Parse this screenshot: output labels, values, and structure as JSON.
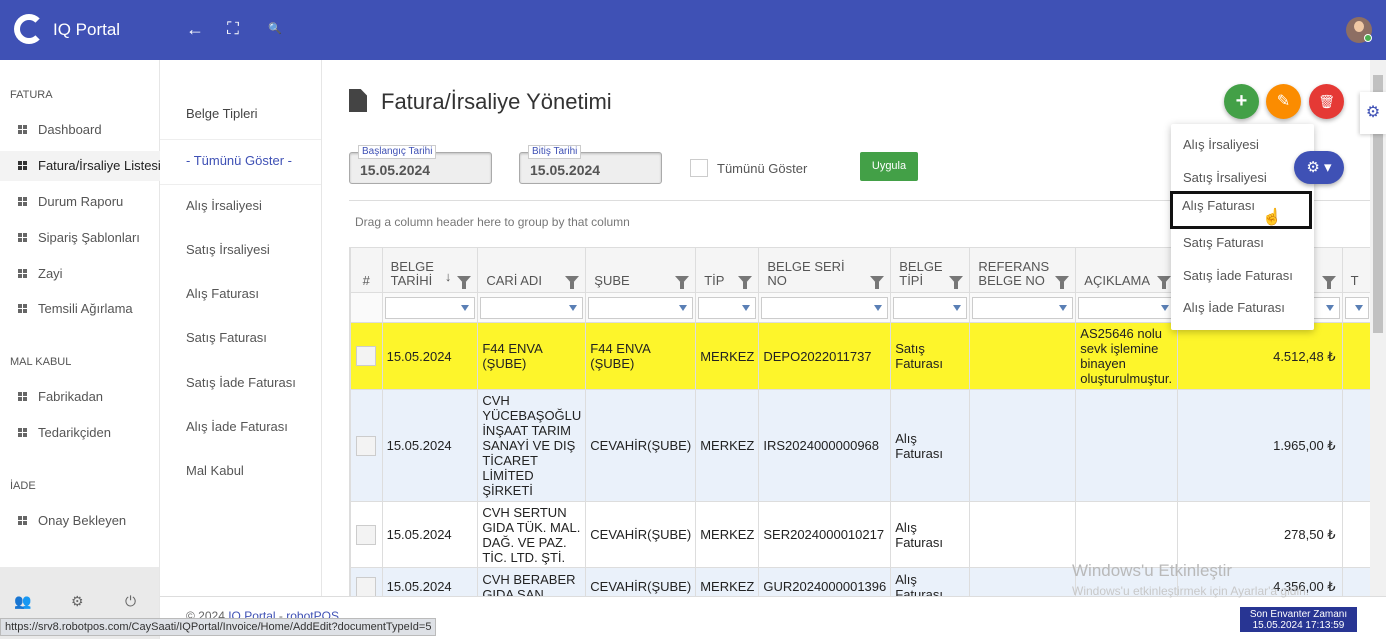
{
  "app": {
    "title": "IQ Portal"
  },
  "topbar": {
    "back_icon": "arrow-left-icon",
    "fullscreen_icon": "expand-icon",
    "search_icon": "search-icon",
    "back_glyph": "←",
    "fullscreen_glyph": "⛶",
    "search_glyph": "🔍"
  },
  "sidebar": {
    "sections": [
      {
        "title": "FATURA",
        "items": [
          "Dashboard",
          "Fatura/İrsaliye Listesi",
          "Durum Raporu",
          "Sipariş Şablonları",
          "Zayi",
          "Temsili Ağırlama"
        ]
      },
      {
        "title": "MAL KABUL",
        "items": [
          "Fabrikadan",
          "Tedarikçiden"
        ]
      },
      {
        "title": "İADE",
        "items": [
          "Onay Bekleyen"
        ]
      }
    ],
    "active_item": "Fatura/İrsaliye Listesi",
    "bottom_glyphs": {
      "users": "👥",
      "settings": "⚙",
      "power": "⏻"
    }
  },
  "subnav": {
    "header": "Belge Tipleri",
    "items": [
      "- Tümünü Göster -",
      "Alış İrsaliyesi",
      "Satış İrsaliyesi",
      "Alış Faturası",
      "Satış Faturası",
      "Satış İade Faturası",
      "Alış İade Faturası",
      "Mal Kabul"
    ]
  },
  "page": {
    "title": "Fatura/İrsaliye Yönetimi",
    "actions": {
      "add": "+",
      "edit": "✎",
      "delete": "🗑"
    },
    "colors": {
      "add": "#43a047",
      "edit": "#fb8c00",
      "delete": "#e53935"
    }
  },
  "filters": {
    "start_label": "Başlangıç Tarihi",
    "start_value": "15.05.2024",
    "end_label": "Bitiş Tarihi",
    "end_value": "15.05.2024",
    "show_all_label": "Tümünü Göster",
    "apply_label": "Uygula"
  },
  "grid": {
    "group_hint": "Drag a column header here to group by that column",
    "columns": [
      "#",
      "BELGE TARİHİ",
      "CARİ ADI",
      "ŞUBE",
      "TİP",
      "BELGE SERİ NO",
      "BELGE TİPİ",
      "REFERANS BELGE NO",
      "AÇIKLAMA",
      "",
      "T"
    ],
    "sort_indicator": "↓",
    "rows": [
      {
        "date": "15.05.2024",
        "cari": "F44 ENVA (ŞUBE)",
        "sube": "F44 ENVA (ŞUBE)",
        "tip": "MERKEZ",
        "seri": "DEPO2022011737",
        "belge_tipi": "Satış Faturası",
        "ref": "",
        "aciklama": "AS25646 nolu sevk işlemine binayen oluşturulmuştur.",
        "tutar": "4.512,48 ₺"
      },
      {
        "date": "15.05.2024",
        "cari": "CVH YÜCEBAŞOĞLU İNŞAAT TARIM SANAYİ VE DIŞ TİCARET LİMİTED ŞİRKETİ",
        "sube": "CEVAHİR(ŞUBE)",
        "tip": "MERKEZ",
        "seri": "IRS2024000000968",
        "belge_tipi": "Alış Faturası",
        "ref": "",
        "aciklama": "",
        "tutar": "1.965,00 ₺"
      },
      {
        "date": "15.05.2024",
        "cari": "CVH SERTUN GIDA TÜK. MAL. DAĞ. VE PAZ. TİC. LTD. ŞTİ.",
        "sube": "CEVAHİR(ŞUBE)",
        "tip": "MERKEZ",
        "seri": "SER2024000010217",
        "belge_tipi": "Alış Faturası",
        "ref": "",
        "aciklama": "",
        "tutar": "278,50 ₺"
      },
      {
        "date": "15.05.2024",
        "cari": "CVH BERABER GIDA SAN",
        "sube": "CEVAHİR(ŞUBE)",
        "tip": "MERKEZ",
        "seri": "GUR2024000001396",
        "belge_tipi": "Alış Faturası",
        "ref": "",
        "aciklama": "",
        "tutar": "4.356,00 ₺"
      }
    ]
  },
  "dropdown": {
    "items": [
      "Alış İrsaliyesi",
      "Satış İrsaliyesi",
      "Alış Faturası",
      "Satış Faturası",
      "Satış İade Faturası",
      "Alış İade Faturası"
    ],
    "hovered": "Alış Faturası",
    "cog_label": "⚙ ▾"
  },
  "footer": {
    "copyright": "© 2024",
    "link1": "IQ Portal",
    "sep": "-",
    "link2": "robotPOS",
    "status_url": "https://srv8.robotpos.com/CaySaati/IQPortal/Invoice/Home/AddEdit?documentTypeId=5",
    "inventory_label": "Son Envanter Zamanı",
    "inventory_time": "15.05.2024 17:13:59"
  },
  "watermark": {
    "line1": "Windows'u Etkinleştir",
    "line2": "Windows'u etkinleştirmek için Ayarlar'a gidin."
  }
}
